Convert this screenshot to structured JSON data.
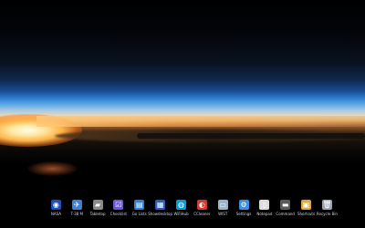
{
  "desktop": {
    "wallpaper": "earth-horizon-sunrise"
  },
  "taskbar": {
    "items": [
      {
        "label": "NASA",
        "icon": "nasa-logo-icon",
        "glyph": "◉",
        "color": "#1d4fb8"
      },
      {
        "label": "T-38 M",
        "icon": "t38-jet-icon",
        "glyph": "✈",
        "color": "#3b82d6"
      },
      {
        "label": "Tabletop",
        "icon": "tabletop-icon",
        "glyph": "▰",
        "color": "#8a8a8a"
      },
      {
        "label": "Checklist",
        "icon": "checklist-icon",
        "glyph": "☑",
        "color": "#6b5bd0"
      },
      {
        "label": "Go Lists",
        "icon": "go-lists-icon",
        "glyph": "▤",
        "color": "#2f7fd6"
      },
      {
        "label": "Showdesktop",
        "icon": "show-desktop-icon",
        "glyph": "▦",
        "color": "#2a5fc0"
      },
      {
        "label": "WiFiHub",
        "icon": "wifi-hub-icon",
        "glyph": "◍",
        "color": "#0a9ad8"
      },
      {
        "label": "CCleaner",
        "icon": "ccleaner-icon",
        "glyph": "◐",
        "color": "#d23a2a"
      },
      {
        "label": "WIST",
        "icon": "wist-icon",
        "glyph": "▭",
        "color": "#9ab4cc"
      },
      {
        "label": "Settings",
        "icon": "settings-gear-icon",
        "glyph": "⚙",
        "color": "#3a8fe0"
      },
      {
        "label": "Notepad",
        "icon": "notepad-icon",
        "glyph": "▯",
        "color": "#dcdcdc"
      },
      {
        "label": "Command",
        "icon": "command-prompt-icon",
        "glyph": "▬",
        "color": "#5a5a5a"
      },
      {
        "label": "Shortcuts",
        "icon": "shortcuts-folder-icon",
        "glyph": "▣",
        "color": "#e0a93a"
      },
      {
        "label": "Recycle Bin",
        "icon": "recycle-bin-icon",
        "glyph": "🗑",
        "color": "#9aa5b3"
      }
    ]
  }
}
